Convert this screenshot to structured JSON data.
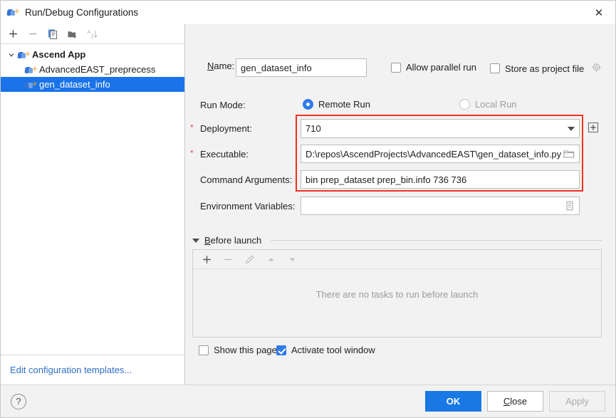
{
  "window": {
    "title": "Run/Debug Configurations",
    "title_icon": "ascend-app-icon",
    "close_icon": "close-icon"
  },
  "sidebar": {
    "toolbar": [
      {
        "name": "add-configuration-button",
        "icon": "plus-icon",
        "glyph": "+",
        "enabled": true
      },
      {
        "name": "remove-configuration-button",
        "icon": "minus-icon",
        "glyph": "−",
        "enabled": false
      },
      {
        "name": "copy-configuration-button",
        "icon": "copy-icon",
        "glyph": "copy",
        "enabled": true
      },
      {
        "name": "new-folder-button",
        "icon": "folder-add-icon",
        "glyph": "folder",
        "enabled": true
      },
      {
        "name": "sort-alphabetically-button",
        "icon": "sort-az-icon",
        "glyph": "az",
        "enabled": false
      }
    ],
    "tree": [
      {
        "label": "Ascend App",
        "level": 0,
        "group": true,
        "expanded": true,
        "selected": false,
        "icon": "ascend-app-icon"
      },
      {
        "label": "AdvancedEAST_preprecess",
        "level": 1,
        "group": false,
        "selected": false,
        "icon": "ascend-app-icon"
      },
      {
        "label": "gen_dataset_info",
        "level": 1,
        "group": false,
        "selected": true,
        "icon": "ascend-app-icon"
      }
    ],
    "footer_link": "Edit configuration templates..."
  },
  "form": {
    "name_label": "Name:",
    "name_value": "gen_dataset_info",
    "allow_parallel_run": {
      "label": "Allow parallel run",
      "checked": false
    },
    "store_as_project_file": {
      "label": "Store as project file",
      "checked": false,
      "icon": "gear-icon"
    },
    "run_mode_label": "Run Mode:",
    "run_mode_options": [
      {
        "label": "Remote Run",
        "selected": true,
        "disabled": false
      },
      {
        "label": "Local Run",
        "selected": false,
        "disabled": true
      }
    ],
    "deployment_label": "Deployment:",
    "deployment_required": "*",
    "deployment_value": "710",
    "deployment_add_icon": "plus-box-icon",
    "executable_label": "Executable:",
    "executable_required": "*",
    "executable_value": "D:\\repos\\AscendProjects\\AdvancedEAST\\gen_dataset_info.py",
    "executable_browse_icon": "folder-icon",
    "command_arguments_label": "Command Arguments:",
    "command_arguments_value": "bin prep_dataset prep_bin.info 736 736",
    "environment_variables_label": "Environment Variables:",
    "environment_variables_value": "",
    "environment_variables_icon": "list-edit-icon"
  },
  "before_launch": {
    "title": "Before launch",
    "expanded": true,
    "toolbar": [
      {
        "name": "add-task-button",
        "icon": "plus-icon",
        "glyph": "+",
        "enabled": true
      },
      {
        "name": "remove-task-button",
        "icon": "minus-icon",
        "glyph": "−",
        "enabled": false
      },
      {
        "name": "edit-task-button",
        "icon": "pencil-icon",
        "glyph": "pencil",
        "enabled": false
      },
      {
        "name": "move-up-button",
        "icon": "arrow-up-icon",
        "glyph": "▲",
        "enabled": false
      },
      {
        "name": "move-down-button",
        "icon": "arrow-down-icon",
        "glyph": "▼",
        "enabled": false
      }
    ],
    "empty_text": "There are no tasks to run before launch"
  },
  "bottom_options": {
    "show_this_page": {
      "label": "Show this page",
      "checked": false
    },
    "activate_tool_window": {
      "label": "Activate tool window",
      "checked": true
    }
  },
  "footer": {
    "help_glyph": "?",
    "help_icon": "help-icon",
    "ok_label": "OK",
    "close_label": "Close",
    "apply_label": "Apply",
    "apply_enabled": false
  },
  "annotations": {
    "highlight_color": "#ee3322"
  }
}
